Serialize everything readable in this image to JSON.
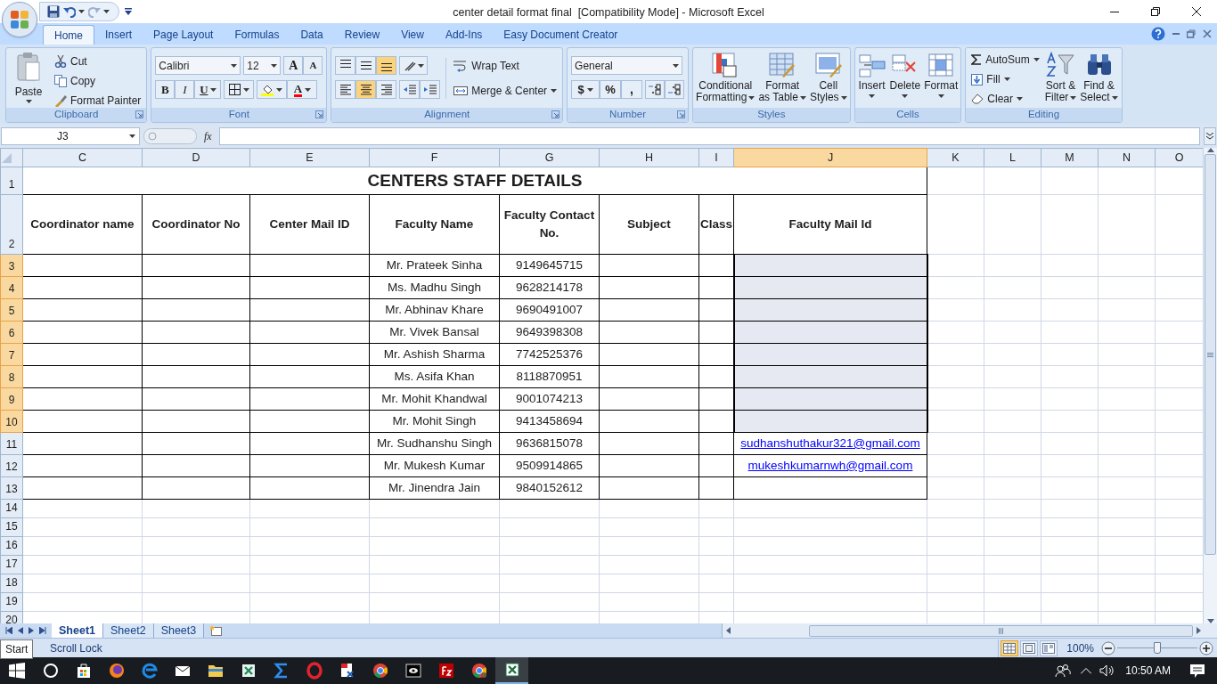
{
  "window": {
    "title": "center detail format final  [Compatibility Mode] - Microsoft Excel"
  },
  "ribbon_tabs": [
    {
      "label": "Home",
      "selected": true
    },
    {
      "label": "Insert",
      "selected": false
    },
    {
      "label": "Page Layout",
      "selected": false
    },
    {
      "label": "Formulas",
      "selected": false
    },
    {
      "label": "Data",
      "selected": false
    },
    {
      "label": "Review",
      "selected": false
    },
    {
      "label": "View",
      "selected": false
    },
    {
      "label": "Add-Ins",
      "selected": false
    },
    {
      "label": "Easy Document Creator",
      "selected": false
    }
  ],
  "clipboard": {
    "label": "Clipboard",
    "paste": "Paste",
    "cut": "Cut",
    "copy": "Copy",
    "format_painter": "Format Painter"
  },
  "font": {
    "label": "Font",
    "name": "Calibri",
    "size": "12",
    "grow": "A",
    "shrink": "A",
    "bold": "B",
    "italic": "I",
    "underline": "U",
    "text_color_letter": "A"
  },
  "alignment": {
    "label": "Alignment",
    "wrap_text": "Wrap Text",
    "merge_center": "Merge & Center",
    "buttons": [
      {
        "kind": "top",
        "selected": false
      },
      {
        "kind": "middle",
        "selected": false
      },
      {
        "kind": "bottom",
        "selected": true
      },
      {
        "kind": "left",
        "selected": false
      },
      {
        "kind": "center",
        "selected": true
      },
      {
        "kind": "right",
        "selected": false
      }
    ]
  },
  "number": {
    "label": "Number",
    "format": "General",
    "currency": "$",
    "percent": "%",
    "comma": ","
  },
  "styles": {
    "label": "Styles",
    "buttons": [
      {
        "kind": "conditional",
        "lines": [
          "Conditional",
          "Formatting"
        ]
      },
      {
        "kind": "table",
        "lines": [
          "Format",
          "as Table"
        ]
      },
      {
        "kind": "cell",
        "lines": [
          "Cell",
          "Styles"
        ]
      }
    ]
  },
  "cells": {
    "label": "Cells",
    "buttons": [
      {
        "kind": "insert",
        "label": "Insert"
      },
      {
        "kind": "delete",
        "label": "Delete"
      },
      {
        "kind": "format",
        "label": "Format"
      }
    ]
  },
  "editing": {
    "label": "Editing",
    "autosum": "AutoSum",
    "fill": "Fill",
    "clear": "Clear",
    "sort_filter": [
      "Sort &",
      "Filter"
    ],
    "find_select": [
      "Find &",
      "Select"
    ]
  },
  "formula_bar": {
    "name_box": "J3",
    "fx": "fx"
  },
  "sheet": {
    "columns": [
      {
        "label": "C",
        "selected": false
      },
      {
        "label": "D",
        "selected": false
      },
      {
        "label": "E",
        "selected": false
      },
      {
        "label": "F",
        "selected": false
      },
      {
        "label": "G",
        "selected": false
      },
      {
        "label": "H",
        "selected": false
      },
      {
        "label": "I",
        "selected": false
      },
      {
        "label": "J",
        "selected": true
      },
      {
        "label": "K",
        "selected": false
      },
      {
        "label": "L",
        "selected": false
      },
      {
        "label": "M",
        "selected": false
      },
      {
        "label": "N",
        "selected": false
      },
      {
        "label": "O",
        "selected": false
      }
    ],
    "row_numbers": [
      {
        "label": "1",
        "selected": false
      },
      {
        "label": "2",
        "selected": false
      },
      {
        "label": "3",
        "selected": true
      },
      {
        "label": "4",
        "selected": true
      },
      {
        "label": "5",
        "selected": true
      },
      {
        "label": "6",
        "selected": true
      },
      {
        "label": "7",
        "selected": true
      },
      {
        "label": "8",
        "selected": true
      },
      {
        "label": "9",
        "selected": true
      },
      {
        "label": "10",
        "selected": true
      },
      {
        "label": "11",
        "selected": false
      },
      {
        "label": "12",
        "selected": false
      },
      {
        "label": "13",
        "selected": false
      },
      {
        "label": "14",
        "selected": false
      },
      {
        "label": "15",
        "selected": false
      },
      {
        "label": "16",
        "selected": false
      },
      {
        "label": "17",
        "selected": false
      },
      {
        "label": "18",
        "selected": false
      },
      {
        "label": "19",
        "selected": false
      },
      {
        "label": "20",
        "selected": false
      }
    ],
    "title": "CENTERS STAFF DETAILS",
    "headings": [
      "Coordinator name",
      "Coordinator No",
      "Center Mail ID",
      "Faculty Name",
      "Faculty Contact No.",
      "Subject",
      "Class",
      "Faculty Mail Id"
    ],
    "rows": [
      {
        "faculty_name": "Mr. Prateek Sinha",
        "contact": "9149645715",
        "selected": true
      },
      {
        "faculty_name": "Ms. Madhu Singh",
        "contact": "9628214178",
        "selected": true
      },
      {
        "faculty_name": "Mr. Abhinav Khare",
        "contact": "9690491007",
        "selected": true
      },
      {
        "faculty_name": "Mr. Vivek Bansal",
        "contact": "9649398308",
        "selected": true
      },
      {
        "faculty_name": "Mr. Ashish Sharma",
        "contact": "7742525376",
        "selected": true
      },
      {
        "faculty_name": "Ms. Asifa Khan",
        "contact": "8118870951",
        "selected": true
      },
      {
        "faculty_name": "Mr. Mohit Khandwal",
        "contact": "9001074213",
        "selected": true
      },
      {
        "faculty_name": "Mr. Mohit Singh",
        "contact": "9413458694",
        "selected": true
      },
      {
        "faculty_name": "Mr. Sudhanshu Singh",
        "contact": "9636815078",
        "mail": "sudhanshuthakur321@gmail.com",
        "selected": false
      },
      {
        "faculty_name": "Mr. Mukesh Kumar",
        "contact": "9509914865",
        "mail": "mukeshkumarnwh@gmail.com",
        "selected": false
      },
      {
        "faculty_name": "Mr. Jinendra Jain",
        "contact": "9840152612",
        "selected": false
      }
    ]
  },
  "sheet_tabs": [
    {
      "label": "Sheet1",
      "selected": true
    },
    {
      "label": "Sheet2",
      "selected": false
    },
    {
      "label": "Sheet3",
      "selected": false
    }
  ],
  "status_bar": {
    "mode": "Scroll Lock",
    "views": [
      {
        "kind": "normal",
        "selected": true
      },
      {
        "kind": "page_layout",
        "selected": false
      },
      {
        "kind": "page_break",
        "selected": false
      }
    ],
    "zoom": "100%",
    "zoom_slider": {
      "level": 0.5
    }
  },
  "tooltip": "Start",
  "taskbar": {
    "clock": "10:50 AM"
  }
}
